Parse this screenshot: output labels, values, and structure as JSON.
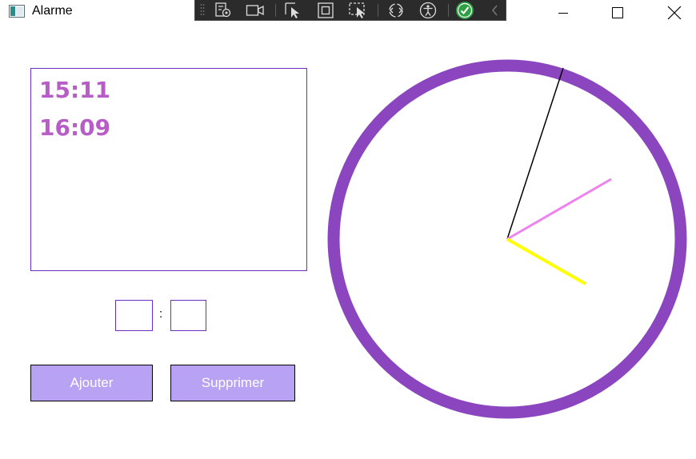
{
  "window": {
    "title": "Alarme"
  },
  "alarms": [
    "15:11",
    "16:09"
  ],
  "time_inputs": {
    "hours": "",
    "separator": ":",
    "minutes": ""
  },
  "buttons": {
    "add_label": "Ajouter",
    "remove_label": "Supprimer"
  },
  "clock": {
    "rim_color": "#8b46bf",
    "hour_hand_color": "#ffff00",
    "minute_hand_color": "#ee82ee",
    "second_hand_color": "#000000"
  },
  "devtools": {
    "icons": [
      "grip-icon",
      "live-visual-tree-icon",
      "video-icon",
      "select-element-icon",
      "display-layout-adorners-icon",
      "track-focus-icon",
      "hot-reload-icon",
      "accessibility-icon",
      "check-circle-icon",
      "collapse-chevron-icon"
    ]
  }
}
